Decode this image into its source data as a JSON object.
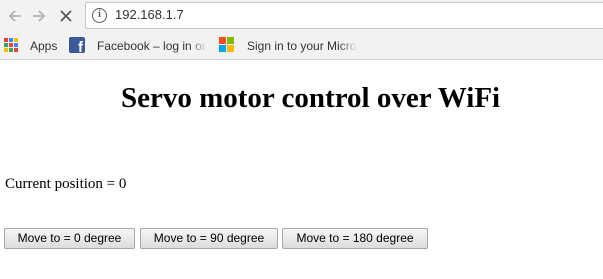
{
  "browser": {
    "url": "192.168.1.7",
    "bookmarks": [
      {
        "label": "Apps",
        "icon": "apps-icon"
      },
      {
        "label": "Facebook – log in or",
        "icon": "facebook-icon"
      },
      {
        "label": "Sign in to your Micro",
        "icon": "microsoft-icon"
      }
    ],
    "icons": {
      "back": "back-arrow-icon",
      "forward": "forward-arrow-icon",
      "stop": "stop-x-icon",
      "info": "info-icon"
    }
  },
  "page": {
    "title": "Servo motor control over WiFi",
    "position_text": "Current position = 0",
    "buttons": [
      {
        "label": "Move to = 0 degree"
      },
      {
        "label": "Move to = 90 degree"
      },
      {
        "label": "Move to = 180 degree"
      }
    ]
  },
  "colors": {
    "facebook": "#3b5998",
    "ms_red": "#f25022",
    "ms_green": "#7fba00",
    "ms_blue": "#00a4ef",
    "ms_yellow": "#ffb900"
  }
}
